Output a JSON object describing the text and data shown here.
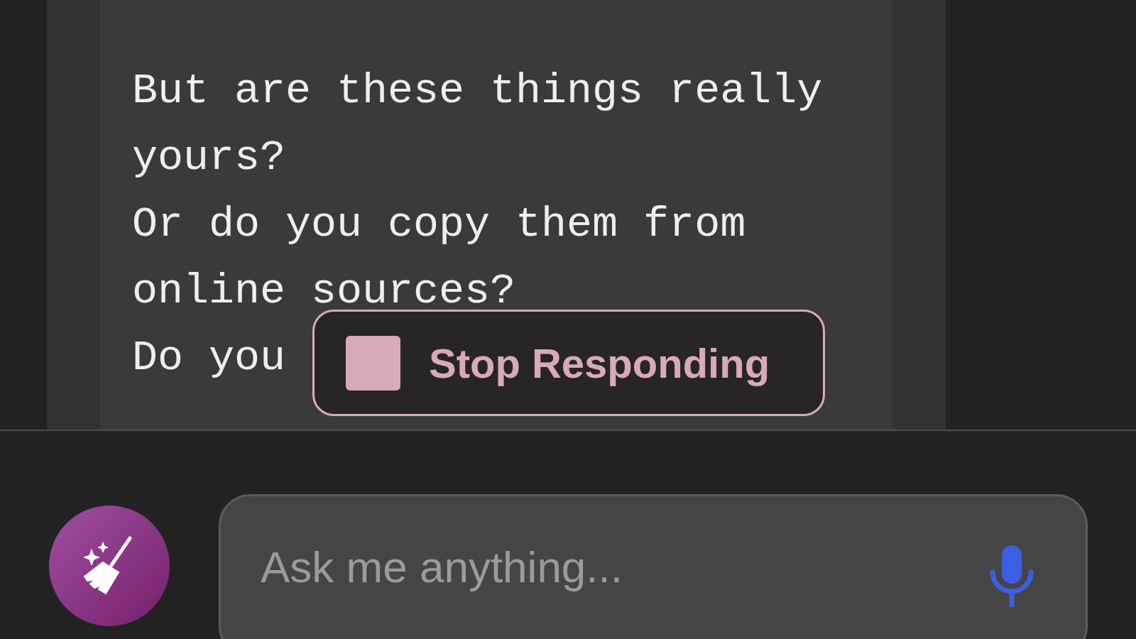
{
  "message": {
    "lines": [
      "But are these things really",
      "yours?",
      "Or do you copy them from",
      "online sources?",
      "Do you"
    ]
  },
  "stop_button": {
    "label": "Stop Responding"
  },
  "composer": {
    "placeholder": "Ask me anything..."
  }
}
